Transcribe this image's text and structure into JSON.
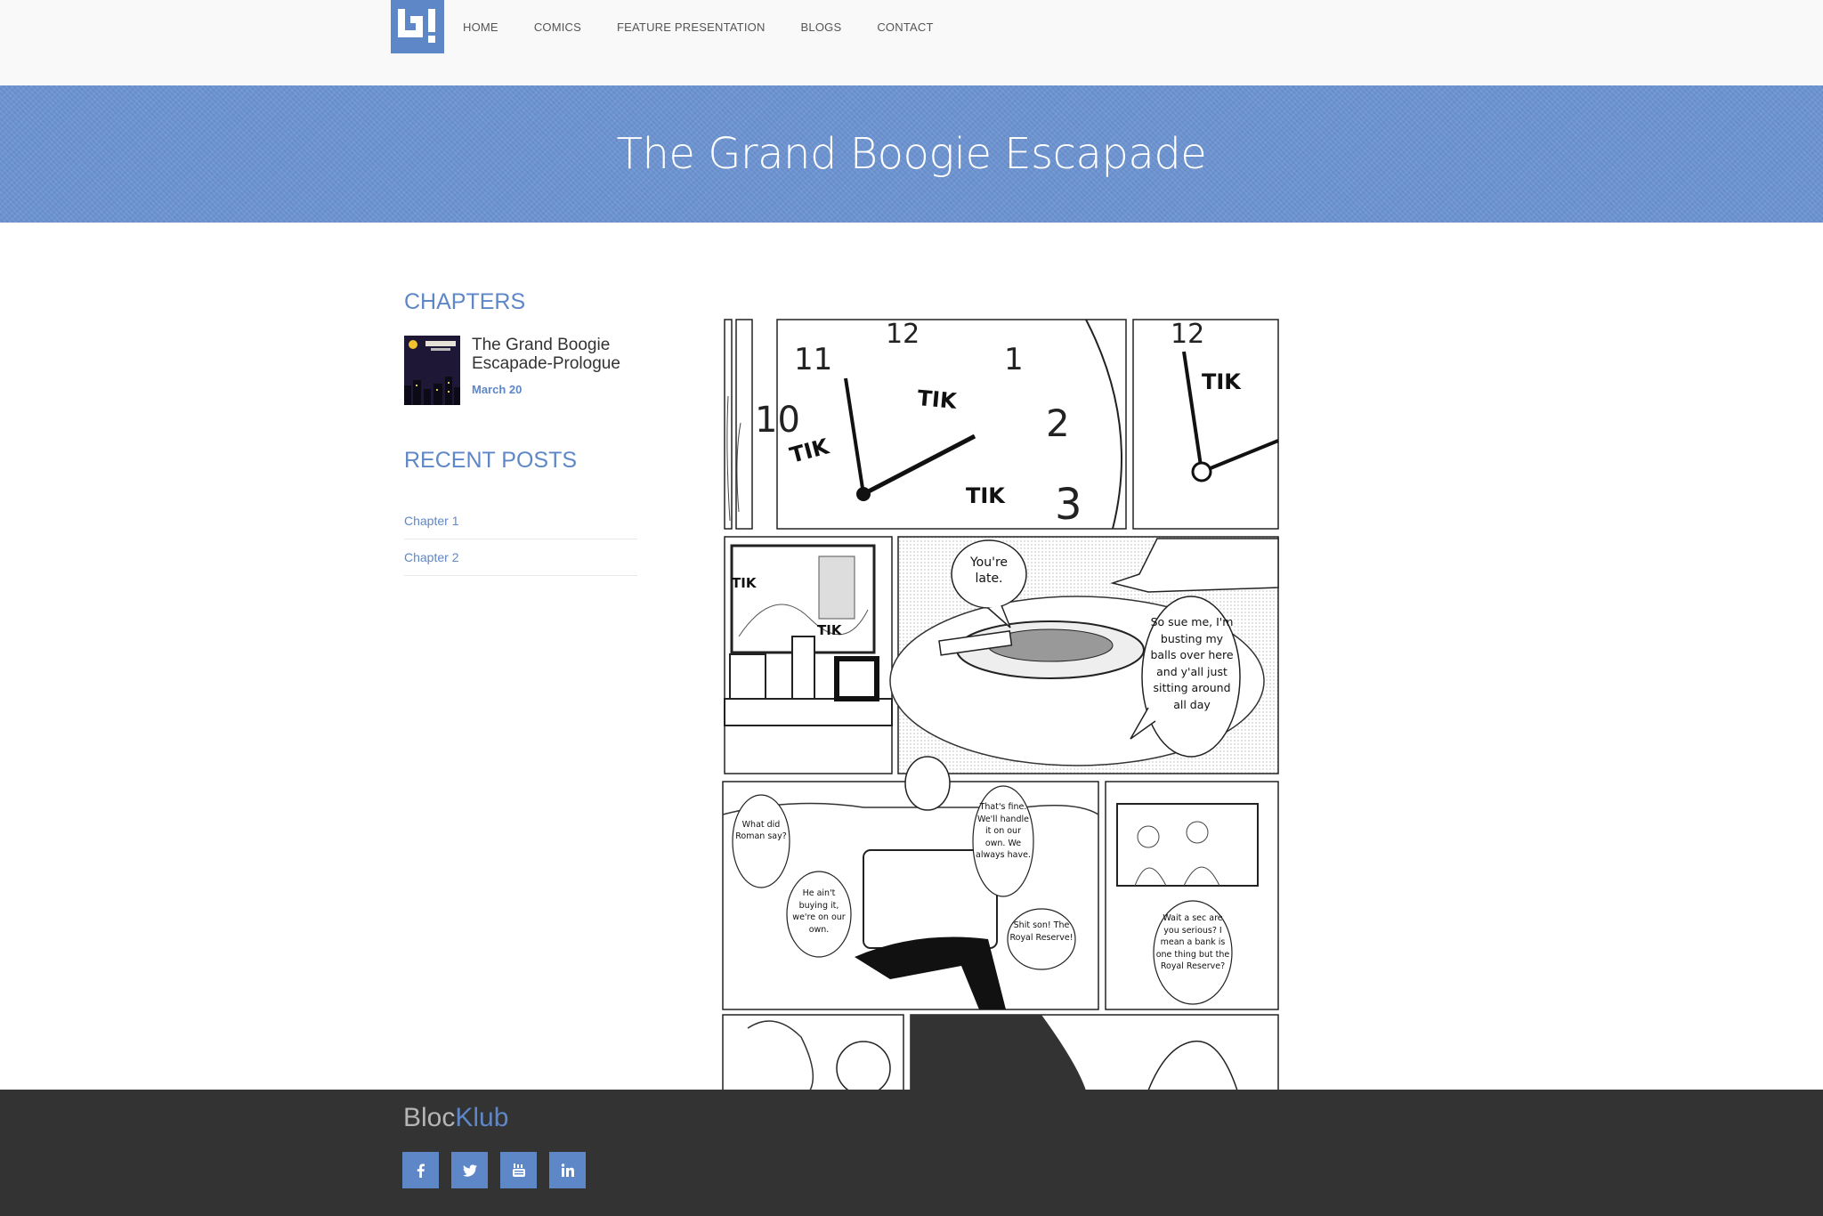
{
  "nav": {
    "items": [
      {
        "label": "HOME"
      },
      {
        "label": "COMICS"
      },
      {
        "label": "FEATURE PRESENTATION"
      },
      {
        "label": "BLOGS"
      },
      {
        "label": "CONTACT"
      }
    ]
  },
  "banner": {
    "title": "The Grand Boogie Escapade"
  },
  "sidebar": {
    "chapters_heading": "CHAPTERS",
    "chapter": {
      "title": "The Grand Boogie Escapade-Prologue",
      "date": "March 20"
    },
    "recent_heading": "RECENT POSTS",
    "recent_posts": [
      "Chapter 1",
      "Chapter 2"
    ]
  },
  "comic": {
    "sfx": [
      "TIK",
      "TIK",
      "TIK",
      "TIK",
      "TIK",
      "TIK"
    ],
    "clock_numbers": [
      "11",
      "12",
      "1",
      "2",
      "3",
      "10",
      "12"
    ],
    "bubbles": [
      "You're late.",
      "So sue me, I'm busting my balls over here and y'all just sitting around all day",
      "What did Roman say?",
      "That's fine. We'll handle it on our own. We always have.",
      "He ain't buying it, we're on our own.",
      "Shit son! The Royal Reserve!",
      "Wait a sec are you serious? I mean a bank is one thing but the Royal Reserve?"
    ]
  },
  "footer": {
    "brand_part1": "Bloc",
    "brand_part2": "Klub",
    "socials": [
      "facebook-icon",
      "twitter-icon",
      "youtube-icon",
      "linkedin-icon"
    ]
  },
  "colors": {
    "accent": "#5e87c8",
    "banner": "#6c94d2",
    "footer": "#333333"
  }
}
